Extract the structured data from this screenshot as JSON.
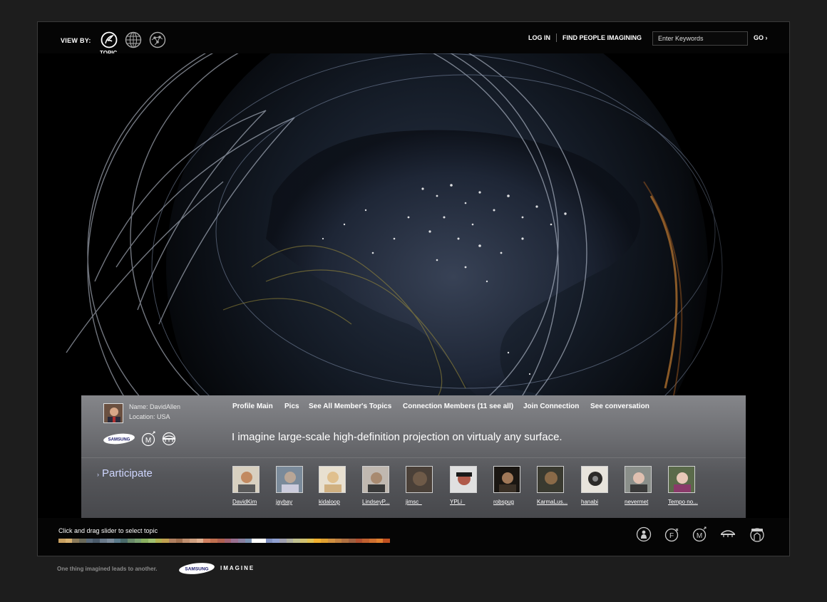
{
  "header": {
    "view_by_label": "VIEW BY:",
    "view_icons": [
      "topic-icon",
      "globe-icon",
      "network-icon"
    ],
    "active_view_label": "TOPIC",
    "login_label": "LOG IN",
    "find_people_label": "FIND PEOPLE IMAGINING",
    "search_placeholder": "Enter Keywords",
    "go_label": "GO ›"
  },
  "profile": {
    "name": "Name: DavidAllen",
    "location": "Location: USA",
    "brand_badge": "SAMSUNG",
    "links": [
      "Profile Main",
      "Pics",
      "See All Member's Topics",
      "Connection Members (11 see all)",
      "Join Connection",
      "See conversation"
    ],
    "statement": "I imagine large-scale high-definition projection on virtualy any surface."
  },
  "participate": {
    "arrow": "›",
    "label": "Participate"
  },
  "members": [
    {
      "name": "DavidKim",
      "color": "#c28a60"
    },
    {
      "name": "jaybay",
      "color": "#b9a696"
    },
    {
      "name": "kidaloop",
      "color": "#e0c08e"
    },
    {
      "name": "LindseyP...",
      "color": "#a88a70"
    },
    {
      "name": "jimsc_",
      "color": "#6e5a48"
    },
    {
      "name": "YPLi_",
      "color": "#b05a4a"
    },
    {
      "name": "robspug",
      "color": "#3a3026"
    },
    {
      "name": "KarmaLus...",
      "color": "#8a6a48"
    },
    {
      "name": "hanabi",
      "color": "#2c2a28"
    },
    {
      "name": "nevermet",
      "color": "#8a8f8a"
    },
    {
      "name": "Tempo no...",
      "color": "#5a6a4a"
    }
  ],
  "bottom": {
    "slider_label": "Click and drag slider to select topic",
    "slider_colors": [
      "#c8a060",
      "#d6b070",
      "#8a7a5a",
      "#6a6a5a",
      "#5a6a7a",
      "#4a5a6a",
      "#6a7a8a",
      "#7a8a9a",
      "#5a7a8a",
      "#4a6a6a",
      "#6a8a6a",
      "#7aa070",
      "#8ab060",
      "#a0c070",
      "#b0b050",
      "#c0a050",
      "#b08060",
      "#a07050",
      "#c09070",
      "#d0a080",
      "#e0b090",
      "#d08060",
      "#c07050",
      "#b06050",
      "#a06070",
      "#9a7090",
      "#8a80a0",
      "#7a90b0",
      "#ffffff",
      "#ffffff",
      "#8090c0",
      "#90a0d0",
      "#a0a0b0",
      "#b0b0a0",
      "#c0c090",
      "#d0c070",
      "#e0c050",
      "#f0b030",
      "#e0a030",
      "#d09040",
      "#c08040",
      "#b07040",
      "#a06040",
      "#b05030",
      "#c06030",
      "#d07030",
      "#e08030",
      "#c05020"
    ],
    "footer_icons": [
      "person-icon",
      "f-circle-icon",
      "m-circle-icon",
      "bridge-icon",
      "house-icon"
    ]
  },
  "footer": {
    "tagline": "One thing imagined leads to another.",
    "brand": "SAMSUNG",
    "wordmark": "IMAGINE"
  }
}
